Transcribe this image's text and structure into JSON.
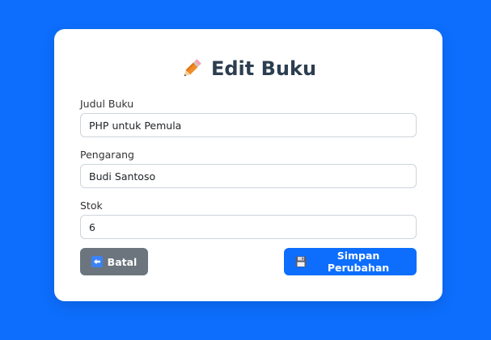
{
  "page": {
    "background_color": "#0d6efd"
  },
  "header": {
    "icon": "pencil-icon",
    "title": "Edit Buku"
  },
  "form": {
    "fields": [
      {
        "label": "Judul Buku",
        "value": "PHP untuk Pemula"
      },
      {
        "label": "Pengarang",
        "value": "Budi Santoso"
      },
      {
        "label": "Stok",
        "value": "6"
      }
    ]
  },
  "actions": {
    "cancel": {
      "icon": "back-arrow-icon",
      "label": "Batal",
      "color": "#6c757d"
    },
    "save": {
      "icon": "floppy-disk-icon",
      "label": "Simpan Perubahan",
      "color": "#0d6efd"
    }
  }
}
